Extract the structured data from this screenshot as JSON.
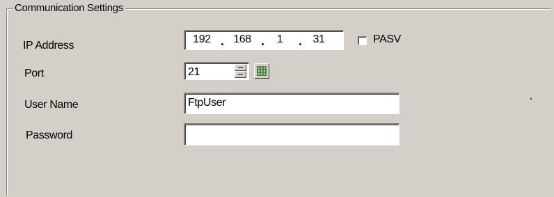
{
  "group": {
    "title": "Communication Settings"
  },
  "ip_address": {
    "label": "IP Address",
    "octets": [
      "192",
      "168",
      "1",
      "31"
    ],
    "separator": "."
  },
  "pasv": {
    "label": "PASV",
    "checked": false
  },
  "port": {
    "label": "Port",
    "value": "21"
  },
  "user_name": {
    "label": "User Name",
    "value": "FtpUser"
  },
  "password": {
    "label": "Password",
    "value": ""
  },
  "icons": {
    "spinner": "spinner-icon",
    "keypad": "keypad-icon"
  }
}
